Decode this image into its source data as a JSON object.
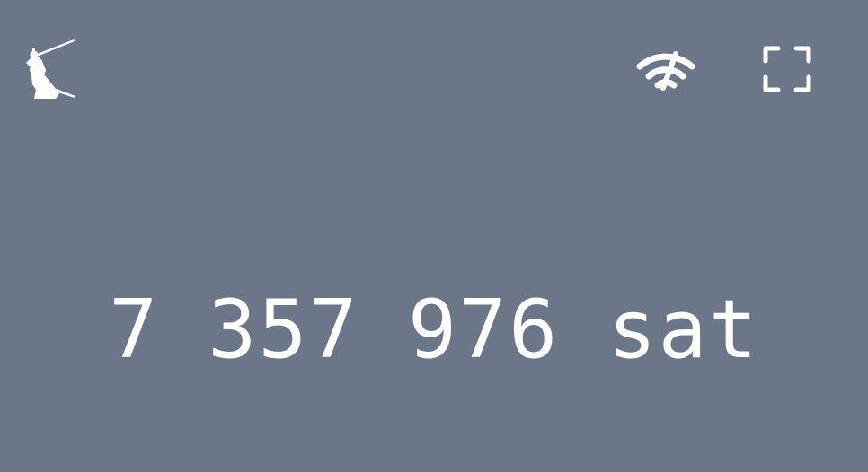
{
  "theme": {
    "background": "#6c7689",
    "foreground": "#ffffff"
  },
  "header": {
    "logo_icon": "samurai-logo-icon",
    "status_icon": "wifi-signal-icon",
    "fullscreen_icon": "fullscreen-icon"
  },
  "balance": {
    "groups": [
      "7",
      "357",
      "976"
    ],
    "unit": "sat"
  }
}
